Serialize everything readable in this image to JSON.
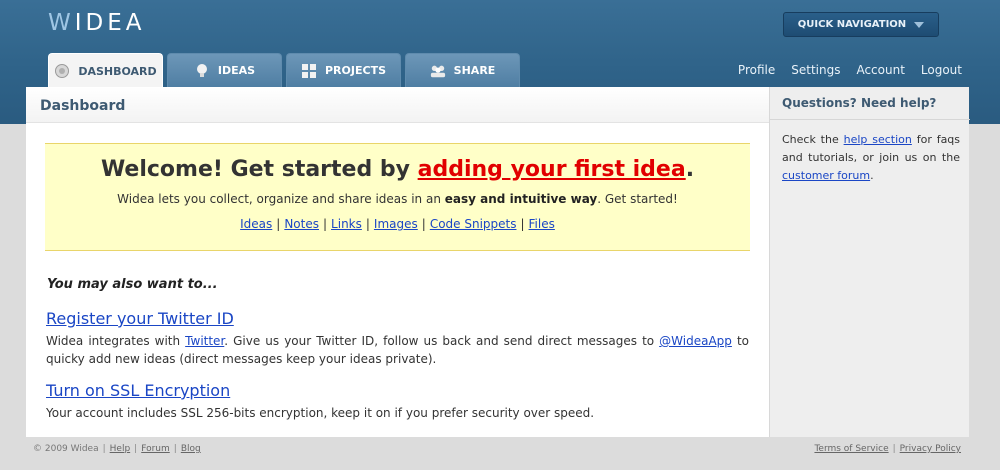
{
  "header": {
    "logo_accent": "W",
    "logo_rest": "IDEA",
    "quick_nav_label": "QUICK NAVIGATION"
  },
  "tabs": [
    {
      "label": "DASHBOARD",
      "icon": "dashboard-icon",
      "active": true
    },
    {
      "label": "IDEAS",
      "icon": "lightbulb-icon",
      "active": false
    },
    {
      "label": "PROJECTS",
      "icon": "grid-icon",
      "active": false
    },
    {
      "label": "SHARE",
      "icon": "people-icon",
      "active": false
    }
  ],
  "user_links": [
    "Profile",
    "Settings",
    "Account",
    "Logout"
  ],
  "main": {
    "title": "Dashboard",
    "welcome": {
      "heading_prefix": "Welcome! Get started by",
      "heading_link": "adding your first idea",
      "heading_suffix": ".",
      "text_prefix": "Widea lets you collect, organize and share ideas in an",
      "text_bold": "easy and intuitive way",
      "text_suffix": ". Get started!",
      "links": [
        "Ideas",
        "Notes",
        "Links",
        "Images",
        "Code Snippets",
        "Files"
      ]
    },
    "also_title": "You may also want to...",
    "twitter": {
      "title": "Register your Twitter ID",
      "desc_1": "Widea integrates with",
      "link_1": "Twitter",
      "desc_2": ". Give us your Twitter ID, follow us back and send direct messages to",
      "link_2": "@WideaApp",
      "desc_3": "to quicky add new ideas (direct messages keep your ideas private)."
    },
    "ssl": {
      "title": "Turn on SSL Encryption",
      "desc": "Your account includes SSL 256-bits encryption, keep it on if you prefer security over speed."
    }
  },
  "sidebar": {
    "title": "Questions? Need help?",
    "text_1": "Check the",
    "link_1": "help section",
    "text_2": "for faqs and tutorials, or join us on the",
    "link_2": "customer forum",
    "text_3": "."
  },
  "footer": {
    "copyright": "© 2009 Widea",
    "left_links": [
      "Help",
      "Forum",
      "Blog"
    ],
    "right_links": [
      "Terms of Service",
      "Privacy Policy"
    ]
  },
  "colors": {
    "header_blue": "#2f6389",
    "link_blue": "#1a46c5",
    "cta_red": "#e10000",
    "welcome_bg": "#ffffc8"
  }
}
